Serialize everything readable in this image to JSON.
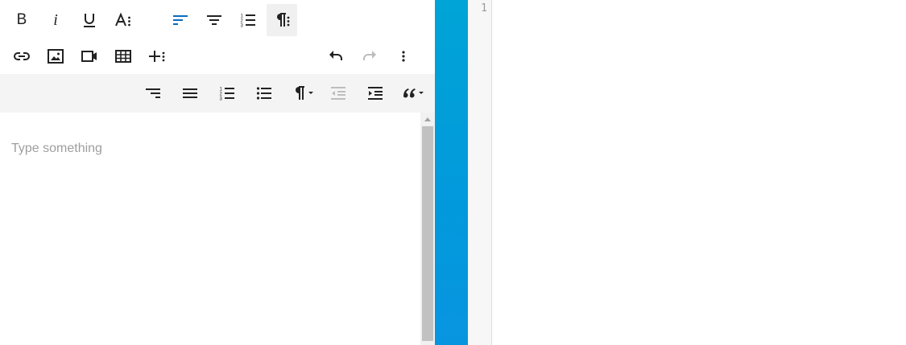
{
  "editor": {
    "placeholder": "Type something",
    "toolbar": {
      "row1": [
        {
          "name": "bold-button",
          "glyph": "B",
          "icon": "bold-icon"
        },
        {
          "name": "italic-button",
          "glyph": "i",
          "icon": "italic-icon"
        },
        {
          "name": "underline-button",
          "icon": "underline-icon"
        },
        {
          "name": "font-style-more-button",
          "icon": "font-style-more-icon"
        },
        {
          "name": "align-left-button",
          "icon": "align-left-icon",
          "active_color": "#0a6cc2"
        },
        {
          "name": "align-center-button",
          "icon": "align-center-icon"
        },
        {
          "name": "ordered-list-button",
          "icon": "ordered-list-icon"
        },
        {
          "name": "paragraph-more-button",
          "icon": "paragraph-more-icon",
          "selected": true
        }
      ],
      "row2": [
        {
          "name": "insert-link-button",
          "icon": "link-icon"
        },
        {
          "name": "insert-image-button",
          "icon": "image-icon"
        },
        {
          "name": "insert-video-button",
          "icon": "video-icon"
        },
        {
          "name": "insert-table-button",
          "icon": "table-icon"
        },
        {
          "name": "insert-more-button",
          "icon": "plus-more-icon"
        },
        {
          "name": "undo-button",
          "icon": "undo-icon"
        },
        {
          "name": "redo-button",
          "icon": "redo-icon",
          "disabled": true
        },
        {
          "name": "more-options-button",
          "icon": "vertical-dots-icon"
        }
      ],
      "row3": [
        {
          "name": "align-right-button",
          "icon": "align-right-icon"
        },
        {
          "name": "align-justify-button",
          "icon": "align-justify-icon"
        },
        {
          "name": "ordered-list-button-2",
          "icon": "ordered-list-icon"
        },
        {
          "name": "unordered-list-button",
          "icon": "unordered-list-icon"
        },
        {
          "name": "paragraph-format-dropdown",
          "icon": "paragraph-icon"
        },
        {
          "name": "outdent-button",
          "icon": "outdent-icon",
          "disabled": true
        },
        {
          "name": "indent-button",
          "icon": "indent-icon"
        },
        {
          "name": "quote-dropdown",
          "icon": "quote-icon"
        }
      ]
    }
  },
  "code_panel": {
    "line_numbers": [
      "1"
    ]
  },
  "colors": {
    "accent_blue": "#0a6cc2",
    "side_bar": "#00a4d6",
    "icon": "#222222",
    "icon_disabled": "#bdbdbd",
    "placeholder": "#9e9e9e"
  }
}
